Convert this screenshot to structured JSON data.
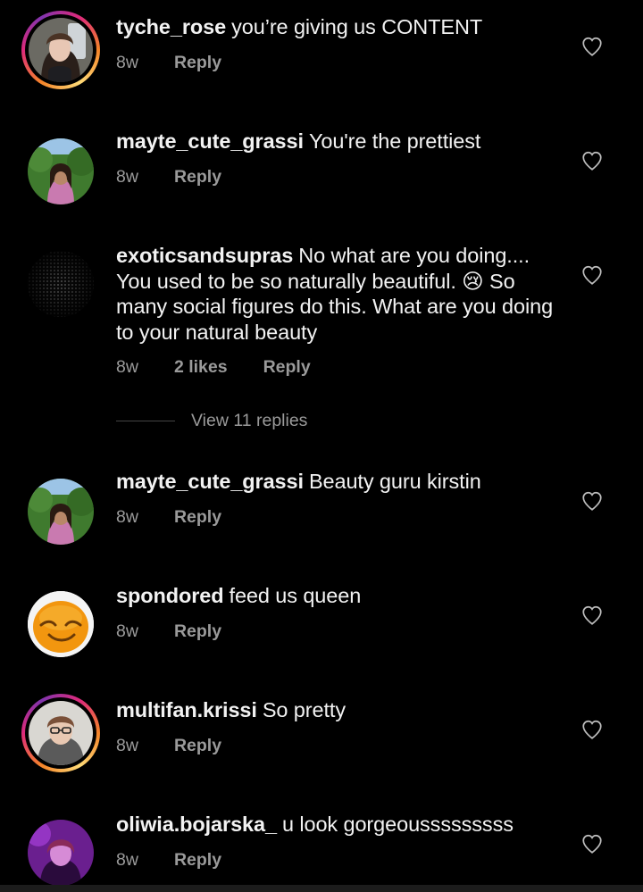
{
  "comments": [
    {
      "username": "tyche_rose",
      "text": "you’re giving us CONTENT",
      "time": "8w",
      "likes": "",
      "reply": "Reply",
      "story_ring": true
    },
    {
      "username": "mayte_cute_grassi",
      "text": "You're the prettiest",
      "time": "8w",
      "likes": "",
      "reply": "Reply",
      "story_ring": false
    },
    {
      "username": "exoticsandsupras",
      "text": "No what are you doing.... You used to be so naturally beautiful. 😢 So many social figures do this. What are you doing to your natural beauty",
      "time": "8w",
      "likes": "2 likes",
      "reply": "Reply",
      "story_ring": false
    },
    {
      "username": "mayte_cute_grassi",
      "text": "Beauty guru kirstin",
      "time": "8w",
      "likes": "",
      "reply": "Reply",
      "story_ring": false
    },
    {
      "username": "spondored",
      "text": "feed us queen",
      "time": "8w",
      "likes": "",
      "reply": "Reply",
      "story_ring": false
    },
    {
      "username": "multifan.krissi",
      "text": "So pretty",
      "time": "8w",
      "likes": "",
      "reply": "Reply",
      "story_ring": true
    },
    {
      "username": "oliwia.bojarska_",
      "text": "u look gorgeousssssssss",
      "time": "8w",
      "likes": "",
      "reply": "Reply",
      "story_ring": false
    }
  ],
  "view_replies_label": "View 11 replies",
  "icons": {
    "like": "heart-outline-icon"
  },
  "colors": {
    "background": "#000000",
    "text": "#f2f2f2",
    "muted": "#9a9a9a"
  }
}
